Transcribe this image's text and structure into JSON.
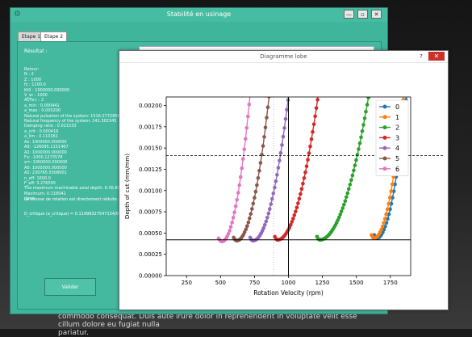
{
  "main_window": {
    "title": "Stabilité en usinage",
    "icon": "app-icon",
    "controls": {
      "minimize": "—",
      "maximize": "▫",
      "close": "✕"
    },
    "tabs": [
      {
        "label": "Etape 1"
      },
      {
        "label": "Etape 2"
      }
    ],
    "result_label": "Résultat :",
    "result_lines": [
      "Retour:",
      "  N       : 2",
      "  Z       : 1000",
      "  fz      : 1100.0",
      "  Kt0     : 1000000.000000",
      "  V_sc    : 1000",
      "  Af/Fe:r : 2",
      "  a_min   : 0.000441",
      "  a_max   : 0.000200",
      "Natural pulsation of the system: 1516.2772856",
      "Natural frequency of the system: 241.302345",
      "Damping ratio          : 0.021533",
      "  a_crit       : 0.000416",
      "  a_lim        : 0.110361",
      "Ax: 1000000.000000",
      "A0: -126095.1151467",
      "A2: 1000000.000000",
      "Fx: -1000.1273578",
      "a=: 1000000.000000",
      "A0: 1000000.000000",
      "A2: 230765.5508001",
      "n_eff: 1600.0",
      "F_eff: 3.276595",
      "The maximum machinable axial depth: 6.36.807",
      "Maximum: 0.118041",
      "done"
    ],
    "note_line_1": "La vitesse de rotation est directement réduite à partir de la machine",
    "note_line_2": "D_critique (a_critique) = 0.11998327547134/0.00041634",
    "validate_label": "Valider"
  },
  "dialog": {
    "title": "Diagramme lobe",
    "help": "?",
    "close": "✕"
  },
  "background_text": [
    "commodo consequat. Duis aute irure dolor in reprehenderit in voluptate velit esse cillum dolore eu fugiat nulla",
    "pariatur."
  ],
  "chart_data": {
    "type": "line",
    "xlabel": "Rotation Velocity (rpm)",
    "ylabel": "Depth of cut (mm/mm)",
    "xlim": [
      100,
      1900
    ],
    "ylim": [
      0,
      0.0021
    ],
    "xticks": [
      "250",
      "500",
      "750",
      "1000",
      "1250",
      "1500",
      "1750"
    ],
    "xtick_values": [
      250,
      500,
      750,
      1000,
      1250,
      1500,
      1750
    ],
    "yticks": [
      "0.00000",
      "0.00025",
      "0.00050",
      "0.00075",
      "0.00100",
      "0.00125",
      "0.00150",
      "0.00175",
      "0.00200"
    ],
    "ytick_values": [
      0,
      0.00025,
      0.0005,
      0.00075,
      0.001,
      0.00125,
      0.0015,
      0.00175,
      0.002
    ],
    "legend_position": "top-right",
    "grid": false,
    "reference_lines": {
      "horizontal_solid": 0.00042,
      "horizontal_dashed": 0.00141,
      "vertical_solid": 1000,
      "vertical_dotted": 890
    },
    "series": [
      {
        "name": "0",
        "color": "#1f77b4",
        "x_min": 1650,
        "x_max": 1900,
        "a_min": 0.00044,
        "k_left": 1.1e-05,
        "k_right": 3.5e-06
      },
      {
        "name": "1",
        "color": "#ff7f0e",
        "x_min": 1630,
        "x_max": 1900,
        "a_min": 0.00044,
        "k_left": 1.1e-05,
        "k_right": 3.5e-06
      },
      {
        "name": "2",
        "color": "#2ca02c",
        "x_min": 1230,
        "x_max": 1900,
        "a_min": 0.00042,
        "k_left": 1e-05,
        "k_right": 1.3e-06
      },
      {
        "name": "3",
        "color": "#d62728",
        "x_min": 920,
        "x_max": 1900,
        "a_min": 0.00042,
        "k_left": 9e-06,
        "k_right": 1.9e-06
      },
      {
        "name": "4",
        "color": "#9467bd",
        "x_min": 740,
        "x_max": 1900,
        "a_min": 0.00041,
        "k_left": 8e-06,
        "k_right": 2.5e-06
      },
      {
        "name": "5",
        "color": "#8c564b",
        "x_min": 620,
        "x_max": 1870,
        "a_min": 0.00041,
        "k_left": 7e-06,
        "k_right": 3e-06
      },
      {
        "name": "6",
        "color": "#e377c2",
        "x_min": 510,
        "x_max": 1600,
        "a_min": 0.0004,
        "k_left": 6.5e-06,
        "k_right": 4e-06
      }
    ]
  }
}
